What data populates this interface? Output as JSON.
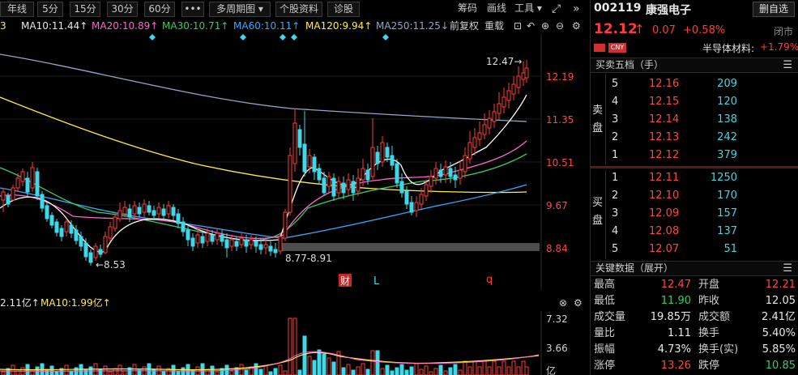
{
  "toolbar": {
    "buttons": [
      "年线",
      "5分",
      "15分",
      "30分",
      "60分",
      "•••",
      "多周期图 ▾",
      "个股资料",
      "诊股"
    ],
    "right_items": [
      "筹码",
      "画线",
      "工具 ▾"
    ],
    "fullscreen_icon": "expand-icon",
    "collapse_icon": "double-chevron-right-icon"
  },
  "ma_legend": {
    "first": "3",
    "ma10": "MA10:11.44↑",
    "ma20": "MA20:10.89↑",
    "ma30": "MA30:10.71↑",
    "ma60": "MA60:10.11↑",
    "ma120": "MA120:9.94↑",
    "ma250": "MA250:11.25↓",
    "adj": "前复权",
    "adj2": "重载",
    "colors": {
      "ma10": "#ffffff",
      "ma20": "#ff66cc",
      "ma30": "#33cc66",
      "ma60": "#33aaff",
      "ma120": "#ffee44",
      "ma250": "#7f9fbf"
    }
  },
  "price_axis": [
    "12.19",
    "11.35",
    "10.51",
    "9.67",
    "8.84"
  ],
  "annotations": {
    "high": "12.47→",
    "low_left": "←8.53",
    "range": "8.77-8.91",
    "markers": [
      "财",
      "L",
      "q"
    ]
  },
  "volume": {
    "legend_first": "2.11亿↑",
    "legend_ma10": "MA10:1.99亿↑",
    "axis": [
      "7.32",
      "3.66",
      "亿"
    ]
  },
  "quote": {
    "code": "002119",
    "name": "康强电子",
    "delete_label": "删自选",
    "price": "12.12",
    "arrow": "↑",
    "change": "0.07",
    "change_pct": "+0.58%",
    "status": "闭市",
    "currency": "CNY",
    "sector": "半导体材料:",
    "sector_pct": "+1.79%"
  },
  "orderbook": {
    "title": "买卖五档（手）",
    "sell_label": [
      "卖",
      "盘"
    ],
    "buy_label": [
      "买",
      "盘"
    ],
    "asks": [
      {
        "lvl": "5",
        "px": "12.16",
        "vol": "209"
      },
      {
        "lvl": "4",
        "px": "12.15",
        "vol": "120"
      },
      {
        "lvl": "3",
        "px": "12.14",
        "vol": "138"
      },
      {
        "lvl": "2",
        "px": "12.13",
        "vol": "242"
      },
      {
        "lvl": "1",
        "px": "12.12",
        "vol": "379"
      }
    ],
    "bids": [
      {
        "lvl": "1",
        "px": "12.11",
        "vol": "1250"
      },
      {
        "lvl": "2",
        "px": "12.10",
        "vol": "170"
      },
      {
        "lvl": "3",
        "px": "12.09",
        "vol": "157"
      },
      {
        "lvl": "4",
        "px": "12.08",
        "vol": "137"
      },
      {
        "lvl": "5",
        "px": "12.07",
        "vol": "51"
      }
    ]
  },
  "key_data": {
    "title": "关键数据（展开）",
    "rows": [
      {
        "l1": "最高",
        "v1": "12.47",
        "c1": "up",
        "l2": "开盘",
        "v2": "12.21",
        "c2": "up"
      },
      {
        "l1": "最低",
        "v1": "11.90",
        "c1": "down",
        "l2": "昨收",
        "v2": "12.05",
        "c2": "flat"
      },
      {
        "l1": "成交量",
        "v1": "19.85万",
        "c1": "flat",
        "l2": "成交额",
        "v2": "2.41亿",
        "c2": "flat"
      },
      {
        "l1": "量比",
        "v1": "1.11",
        "c1": "flat",
        "l2": "换手",
        "v2": "5.40%",
        "c2": "flat"
      },
      {
        "l1": "振幅",
        "v1": "4.73%",
        "c1": "flat",
        "l2": "换手(实)",
        "v2": "5.85%",
        "c2": "flat"
      },
      {
        "l1": "涨停",
        "v1": "13.26",
        "c1": "up",
        "l2": "跌停",
        "v2": "10.85",
        "c2": "down"
      }
    ]
  }
}
